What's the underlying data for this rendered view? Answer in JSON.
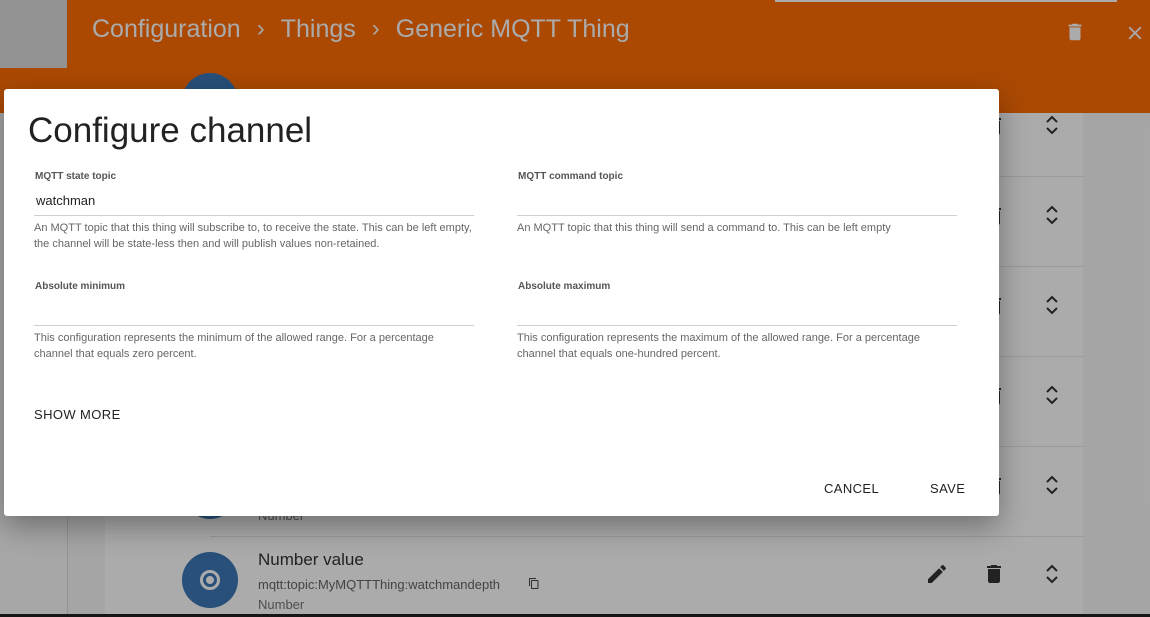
{
  "header": {
    "breadcrumb": [
      "Configuration",
      "Things",
      "Generic MQTT Thing"
    ],
    "separator": "›",
    "color": "#ff6d05"
  },
  "channel": {
    "title": "Number value",
    "uid": "mqtt:topic:MyMQTTThing:watchmandepth",
    "type": "Number",
    "type_peek": "Number",
    "color": "#3d78b8"
  },
  "dialog": {
    "title": "Configure channel",
    "fields": [
      {
        "label": "MQTT state topic",
        "value": "watchman",
        "help": "An MQTT topic that this thing will subscribe to, to receive the state. This can be left empty, the channel will be state-less then and will publish values non-retained."
      },
      {
        "label": "MQTT command topic",
        "value": "",
        "help": "An MQTT topic that this thing will send a command to. This can be left empty"
      },
      {
        "label": "Absolute minimum",
        "value": "",
        "help": "This configuration represents the minimum of the allowed range. For a percentage channel that equals zero percent."
      },
      {
        "label": "Absolute maximum",
        "value": "",
        "help": "This configuration represents the maximum of the allowed range. For a percentage channel that equals one-hundred percent."
      }
    ],
    "show_more": "SHOW MORE",
    "cancel": "CANCEL",
    "save": "SAVE"
  },
  "icons": {
    "delete": "trash-icon",
    "close": "close-icon",
    "edit": "pencil-icon",
    "reorder": "unfold-icon",
    "copy": "copy-icon"
  }
}
